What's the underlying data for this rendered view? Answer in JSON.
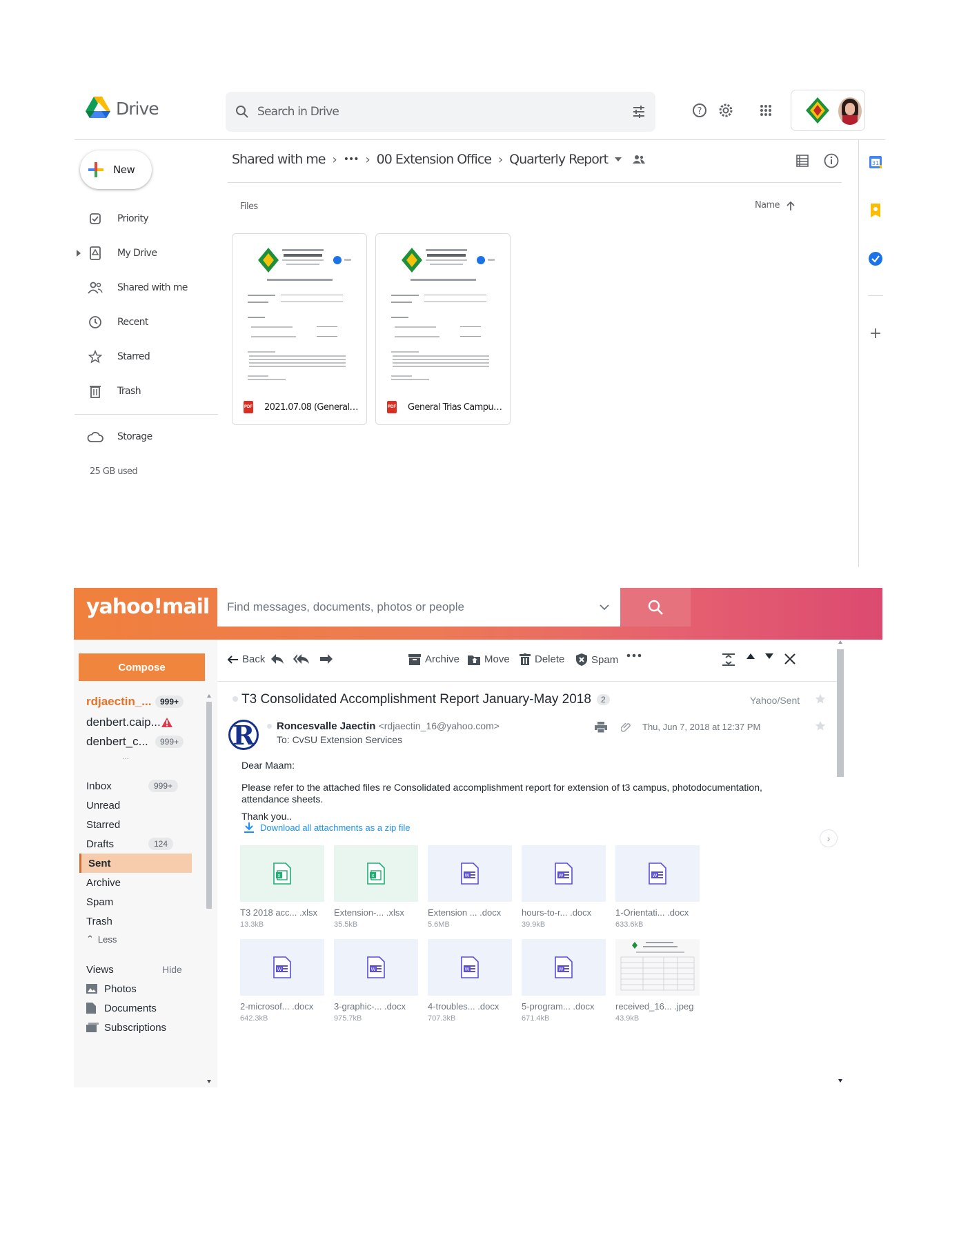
{
  "drive": {
    "app_name": "Drive",
    "search_placeholder": "Search in Drive",
    "new_label": "New",
    "nav": [
      {
        "label": "Priority"
      },
      {
        "label": "My Drive"
      },
      {
        "label": "Shared with me"
      },
      {
        "label": "Recent"
      },
      {
        "label": "Starred"
      },
      {
        "label": "Trash"
      }
    ],
    "storage_label": "Storage",
    "storage_used": "25 GB used",
    "breadcrumb": [
      "Shared with me",
      "•••",
      "00 Extension Office",
      "Quarterly Report"
    ],
    "files_label": "Files",
    "sort_label": "Name",
    "files": [
      {
        "name": "2021.07.08 (General Tria..."
      },
      {
        "name": "General Trias Campus Fir..."
      }
    ],
    "colors": {
      "accent": "#1a73e8",
      "pdf": "#d93025"
    }
  },
  "yahoo": {
    "logo": "yahoo!mail",
    "search_placeholder": "Find messages, documents, photos or people",
    "compose_label": "Compose",
    "accounts": [
      {
        "name": "rdjaectin_...",
        "count": "999+"
      },
      {
        "name": "denbert.caip...",
        "count": ""
      },
      {
        "name": "denbert_c...",
        "count": "999+"
      }
    ],
    "more": "...",
    "folders": [
      {
        "label": "Inbox",
        "count": "999+"
      },
      {
        "label": "Unread",
        "count": ""
      },
      {
        "label": "Starred",
        "count": ""
      },
      {
        "label": "Drafts",
        "count": "124"
      },
      {
        "label": "Sent",
        "count": ""
      },
      {
        "label": "Archive",
        "count": ""
      },
      {
        "label": "Spam",
        "count": ""
      },
      {
        "label": "Trash",
        "count": ""
      }
    ],
    "less_label": "Less",
    "views_label": "Views",
    "hide_label": "Hide",
    "views": [
      {
        "label": "Photos"
      },
      {
        "label": "Documents"
      },
      {
        "label": "Subscriptions"
      }
    ],
    "toolbar": {
      "back": "Back",
      "archive": "Archive",
      "move": "Move",
      "delete": "Delete",
      "spam": "Spam"
    },
    "message": {
      "subject": "T3 Consolidated Accomplishment Report January-May 2018",
      "thread_count": "2",
      "folder": "Yahoo/Sent",
      "sender_name": "Roncesvalle Jaectin",
      "sender_email": "<rdjaectin_16@yahoo.com>",
      "to": "To: CvSU Extension Services",
      "date": "Thu, Jun 7, 2018 at 12:37 PM",
      "greeting": "Dear Maam:",
      "body": "Please refer to the attached files re Consolidated accomplishment report for extension of t3 campus, photodocumentation, attendance sheets.",
      "closing": "Thank you..",
      "download_all": "Download all attachments as a zip file"
    },
    "attachments": [
      {
        "name": "T3 2018 acc...  .xlsx",
        "size": "13.3kB",
        "type": "xlsx"
      },
      {
        "name": "Extension-...  .xlsx",
        "size": "35.5kB",
        "type": "xlsx"
      },
      {
        "name": "Extension ...  .docx",
        "size": "5.6MB",
        "type": "docx"
      },
      {
        "name": "hours-to-r...  .docx",
        "size": "39.9kB",
        "type": "docx"
      },
      {
        "name": "1-Orientati...  .docx",
        "size": "633.6kB",
        "type": "docx"
      },
      {
        "name": "2-microsof...  .docx",
        "size": "642.3kB",
        "type": "docx"
      },
      {
        "name": "3-graphic-...  .docx",
        "size": "975.7kB",
        "type": "docx"
      },
      {
        "name": "4-troubles...  .docx",
        "size": "707.3kB",
        "type": "docx"
      },
      {
        "name": "5-program...  .docx",
        "size": "671.4kB",
        "type": "docx"
      },
      {
        "name": "received_16...  .jpeg",
        "size": "43.9kB",
        "type": "jpeg"
      }
    ],
    "colors": {
      "compose": "#f0863d",
      "link": "#188fff",
      "selected_folder": "#f6ccad",
      "account_active": "#e5742b"
    }
  }
}
